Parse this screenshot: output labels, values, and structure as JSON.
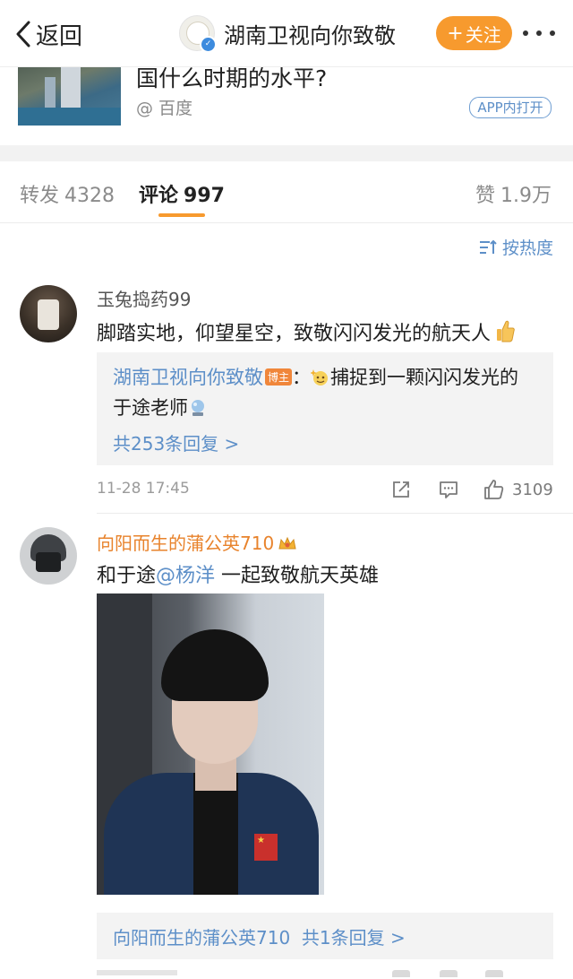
{
  "nav": {
    "back_label": "返回",
    "title": "湖南卫视向你致敬",
    "follow_label": "关注"
  },
  "share_card": {
    "title": "国什么时期的水平?",
    "source": "@ 百度",
    "open_app_label": "APP内打开"
  },
  "tabs": {
    "repost": {
      "label": "转发",
      "count": "4328"
    },
    "comment": {
      "label": "评论",
      "count": "997"
    },
    "like": {
      "label": "赞",
      "count": "1.9万"
    }
  },
  "sort": {
    "label": "按热度"
  },
  "comments": [
    {
      "username": "玉兔捣药99",
      "text": "脚踏实地，仰望星空，致敬闪闪发光的航天人",
      "reply": {
        "author": "湖南卫视向你致敬",
        "tag": "博主",
        "line1_text": "捕捉到一颗闪闪发光的",
        "line2_text": "于途老师",
        "count_label": "共253条回复 >"
      },
      "timestamp": "11-28 17:45",
      "like_count": "3109"
    },
    {
      "username": "向阳而生的蒲公英710",
      "text_before": "和于途",
      "mention": "@杨洋",
      "text_after": " 一起致敬航天英雄",
      "reply_summary_author": "向阳而生的蒲公英710",
      "reply_summary_count": "共1条回复 >"
    }
  ],
  "colors": {
    "accent_orange": "#f79a2e",
    "link_blue": "#5d8fc8",
    "username_orange": "#e8832c"
  }
}
